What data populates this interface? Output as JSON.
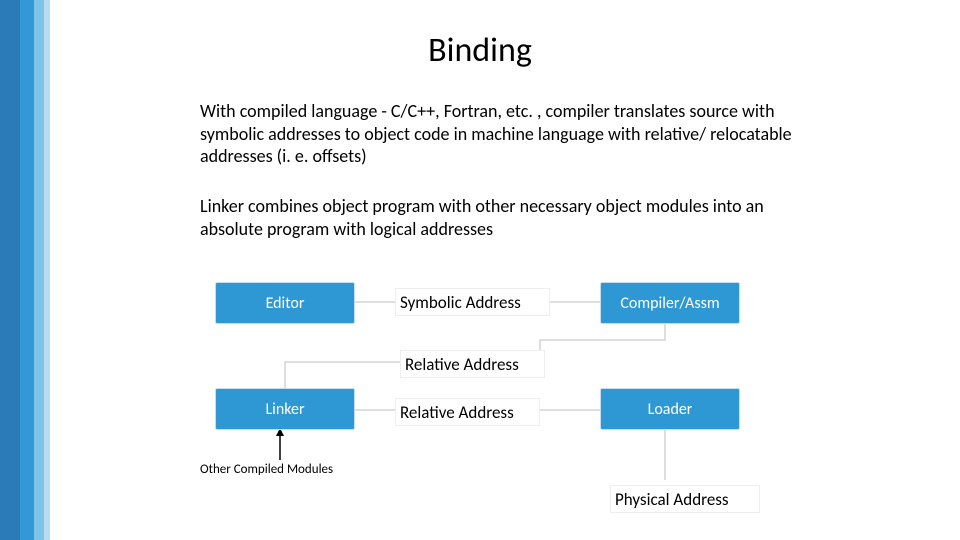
{
  "title": "Binding",
  "paragraphs": {
    "p1": "With compiled language - C/C++, Fortran, etc. , compiler translates source with symbolic addresses to object code in machine language with relative/ relocatable addresses (i. e. offsets)",
    "p2": "Linker combines object program with other necessary object modules into an absolute program with logical addresses"
  },
  "boxes": {
    "editor": "Editor",
    "compiler": "Compiler/Assm",
    "linker": "Linker",
    "loader": "Loader"
  },
  "labels": {
    "symbolic": "Symbolic Address",
    "relative1": "Relative Address",
    "relative2": "Relative Address",
    "physical": "Physical Address",
    "other_modules": "Other Compiled Modules"
  }
}
